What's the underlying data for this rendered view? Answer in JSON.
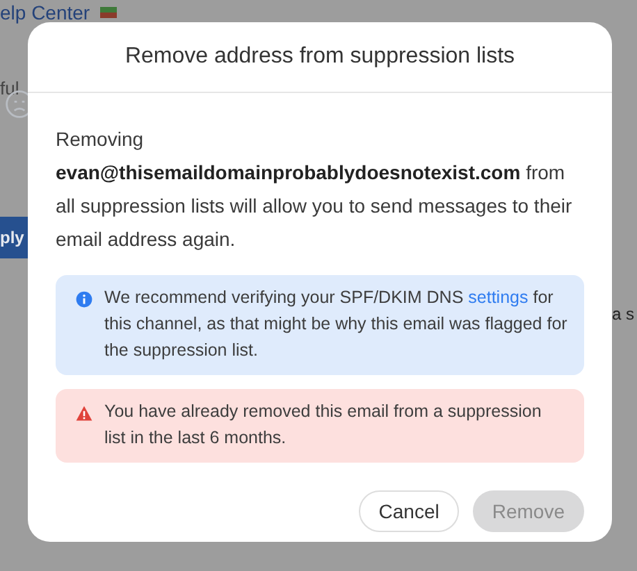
{
  "background": {
    "link": "elp Center",
    "text_1": "ful",
    "button": "ply",
    "text_2": "a s"
  },
  "dialog": {
    "title": "Remove address from suppression lists",
    "message": "Removing **evan@thisemaildomainprobablydoesnotexist.com** from all suppression lists will allow you to send messages to their email address again.",
    "notices": [
      {
        "kind": "info",
        "text": "We recommend verifying your SPF/DKIM DNS ",
        "link": "settings",
        "text_after": " for this channel, as that might be why this email was flagged for the suppression list."
      },
      {
        "kind": "warning",
        "text": "You have already removed this email from a suppression list in the last 6 months."
      }
    ],
    "buttons": [
      {
        "label": "Cancel",
        "disabled": false
      },
      {
        "label": "Remove",
        "disabled": true
      }
    ]
  }
}
